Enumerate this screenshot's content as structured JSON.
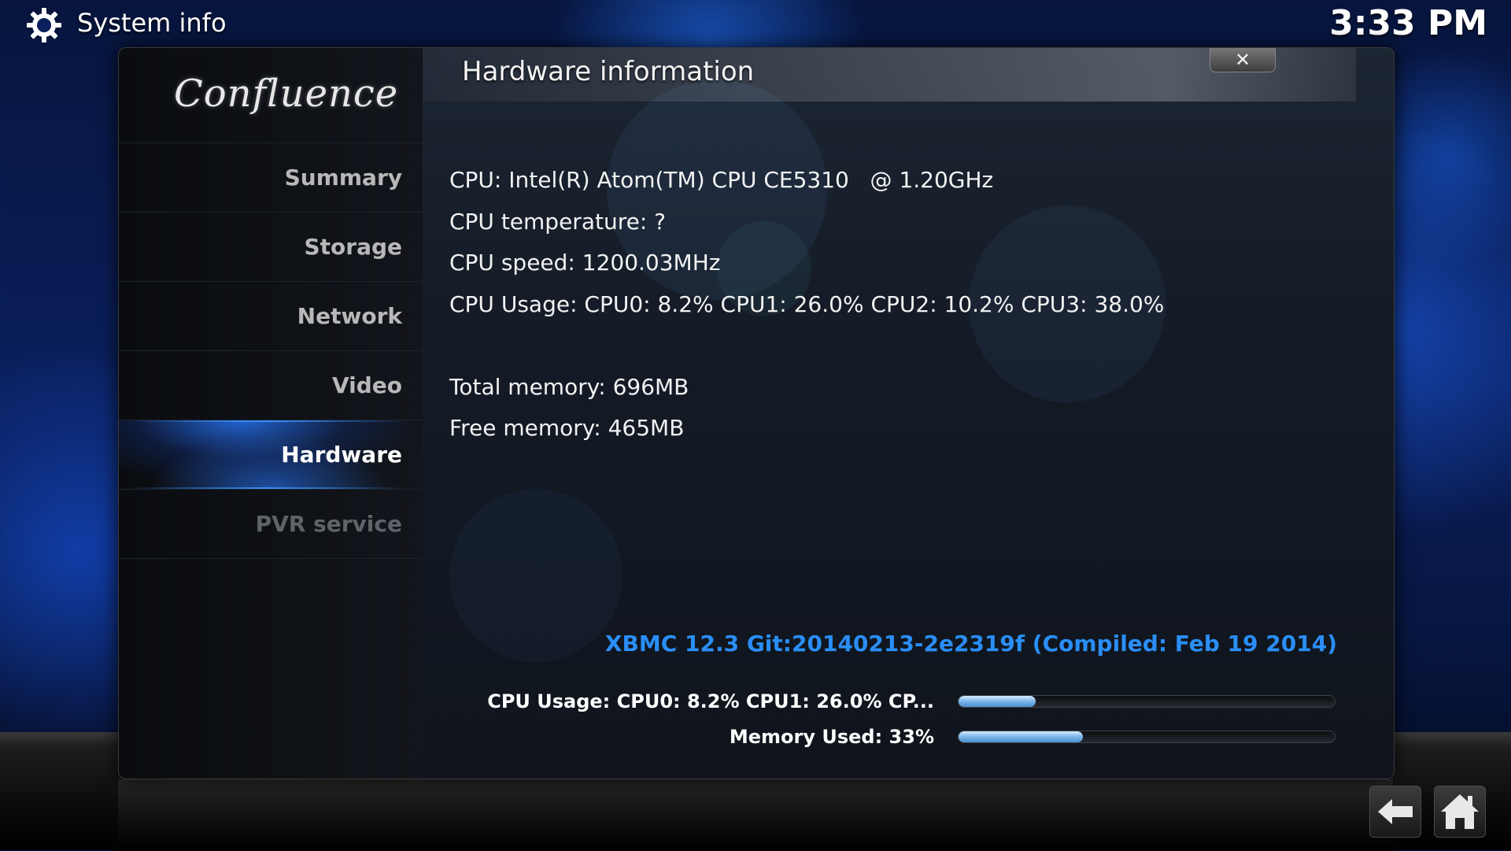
{
  "top_bar": {
    "section_icon": "gear-icon",
    "title": "System info",
    "clock": "3:33 PM"
  },
  "sidebar": {
    "logo_text": "Confluence",
    "items": [
      {
        "label": "Summary",
        "state": "normal"
      },
      {
        "label": "Storage",
        "state": "normal"
      },
      {
        "label": "Network",
        "state": "normal"
      },
      {
        "label": "Video",
        "state": "normal"
      },
      {
        "label": "Hardware",
        "state": "selected"
      },
      {
        "label": "PVR service",
        "state": "disabled"
      }
    ]
  },
  "dialog": {
    "title": "Hardware information",
    "close_icon": "close-icon",
    "close_label": "✕"
  },
  "hardware": {
    "cpu": "CPU: Intel(R) Atom(TM) CPU CE5310   @ 1.20GHz",
    "cpu_temperature": "CPU temperature: ?",
    "cpu_speed": "CPU speed: 1200.03MHz",
    "cpu_usage": "CPU Usage: CPU0: 8.2% CPU1: 26.0% CPU2: 10.2% CPU3: 38.0%",
    "total_memory": "Total memory: 696MB",
    "free_memory": "Free memory: 465MB"
  },
  "build_info": "XBMC 12.3 Git:20140213-2e2319f (Compiled: Feb 19 2014)",
  "stats": {
    "cpu_label": "CPU Usage: CPU0: 8.2% CPU1: 26.0% CP...",
    "cpu_fraction": 0.205,
    "memory_label": "Memory Used: 33%",
    "memory_fraction": 0.33
  },
  "nav": {
    "back_icon": "back-arrow-icon",
    "home_icon": "home-icon"
  },
  "colors": {
    "accent": "#2a8ef7",
    "selected_glow": "#2878ff",
    "bar_fill": "#79b5e8"
  }
}
